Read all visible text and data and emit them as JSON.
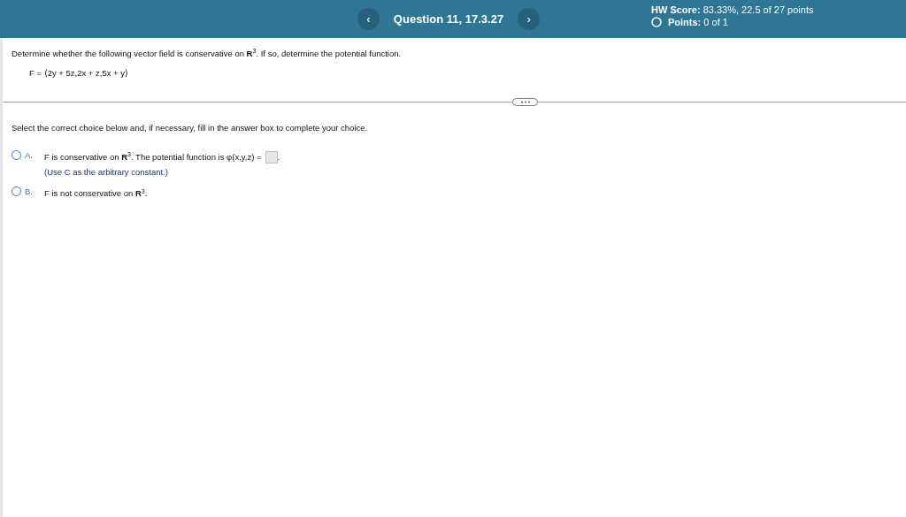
{
  "header": {
    "prev_button": "‹",
    "question_title": "Question 11, 17.3.27",
    "next_button": "›",
    "hw_score_label": "HW Score:",
    "hw_score_value": "83.33%, 22.5 of 27 points",
    "points_label": "Points:",
    "points_value": "0 of 1"
  },
  "question": {
    "prompt": "Determine whether the following vector field is conservative on **R**$^{3}$. If so, determine the potential function.",
    "formula": "F = ⟨2y + 5z,2x + z,5x + y⟩"
  },
  "instruction": "Select the correct choice below and, if necessary, fill in the answer box to complete your choice.",
  "choices": [
    {
      "kind": "fill_in",
      "letter": "A.",
      "text": "F is conservative on **R**$^{3}$. The potential function is φ(x,y,z) =",
      "after_box": ".",
      "hint": "(Use C as the arbitrary constant.)",
      "selected": false
    },
    {
      "kind": "statement",
      "letter": "B.",
      "text": "F is not conservative on **R**$^{3}$.",
      "selected": false
    }
  ]
}
